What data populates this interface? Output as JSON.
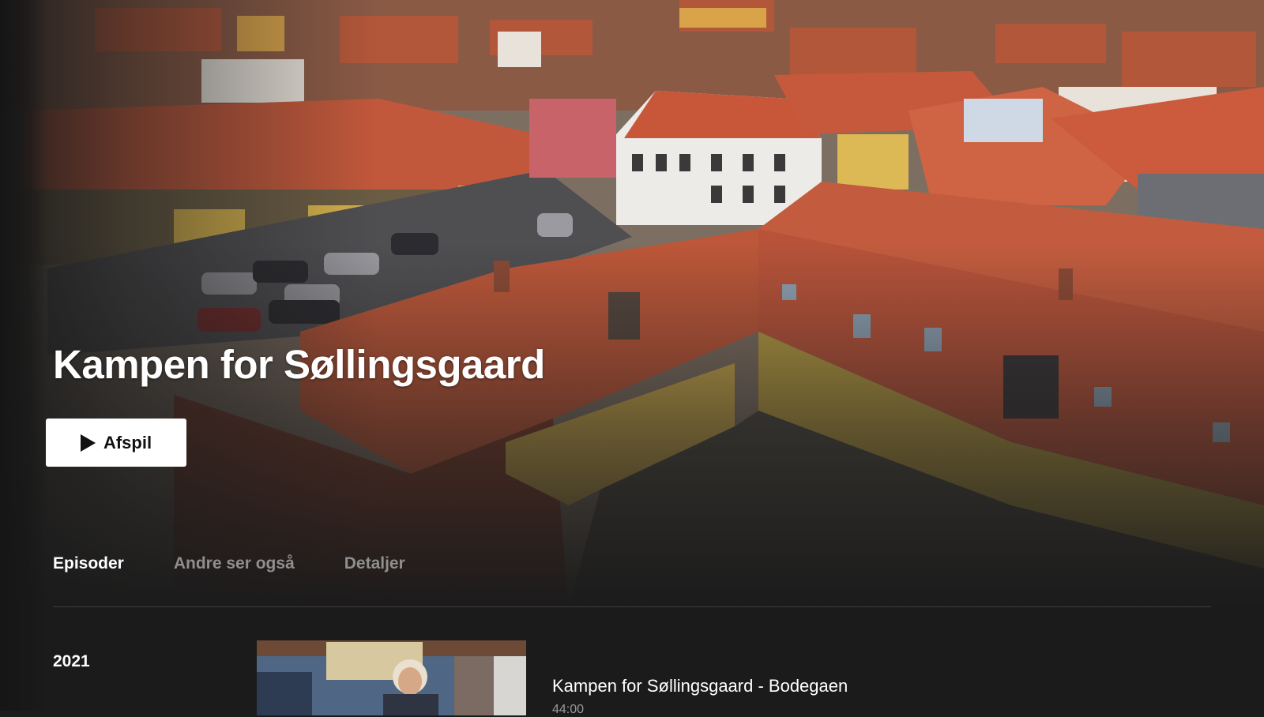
{
  "show": {
    "title": "Kampen for Søllingsgaard",
    "play_label": "Afspil"
  },
  "tabs": [
    {
      "label": "Episoder",
      "active": true
    },
    {
      "label": "Andre ser også",
      "active": false
    },
    {
      "label": "Detaljer",
      "active": false
    }
  ],
  "episodes_section": {
    "season": "2021",
    "episodes": [
      {
        "title": "Kampen for Søllingsgaard - Bodegaen",
        "duration": "44:00"
      }
    ]
  },
  "icons": {
    "play": "play-icon"
  },
  "colors": {
    "background": "#1b1b1b",
    "button_bg": "#ffffff",
    "tab_active": "#ffffff",
    "tab_inactive": "#8f8f8f"
  }
}
